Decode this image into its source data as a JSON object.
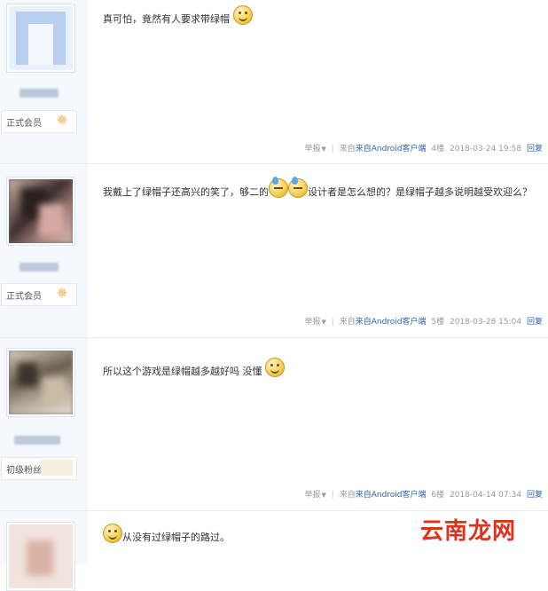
{
  "posts": [
    {
      "rank": "正式会员",
      "text_parts": [
        "真可怕，竟然有人要求带绿帽"
      ],
      "meta": {
        "report": "举报",
        "source": "来自Android客户端",
        "floor": "4楼",
        "time": "2018-03-24 19:58",
        "reply": "回复"
      }
    },
    {
      "rank": "正式会员",
      "text_parts": [
        "我戴上了绿帽子还高兴的笑了，够二的",
        "设计者是怎么想的？是绿帽子越多说明越受欢迎么？"
      ],
      "meta": {
        "report": "举报",
        "source": "来自Android客户端",
        "floor": "5楼",
        "time": "2018-03-28 15:04",
        "reply": "回复"
      }
    },
    {
      "rank": "初级粉丝",
      "text_parts": [
        "所以这个游戏是绿帽越多越好吗 没懂"
      ],
      "meta": {
        "report": "举报",
        "source": "来自Android客户端",
        "floor": "6楼",
        "time": "2018-04-14 07:34",
        "reply": "回复"
      }
    },
    {
      "text_parts": [
        "从没有过绿帽子的路过。"
      ]
    }
  ],
  "watermark": "云南龙网",
  "colors": {
    "link": "#2d64b3",
    "sidebar": "#f5f8fc",
    "meta": "#999999",
    "watermark": "#e0301e"
  },
  "icons": [
    "smiley-emoji",
    "sweat-emoji",
    "rank-badge-icon",
    "dropdown-caret-icon"
  ]
}
